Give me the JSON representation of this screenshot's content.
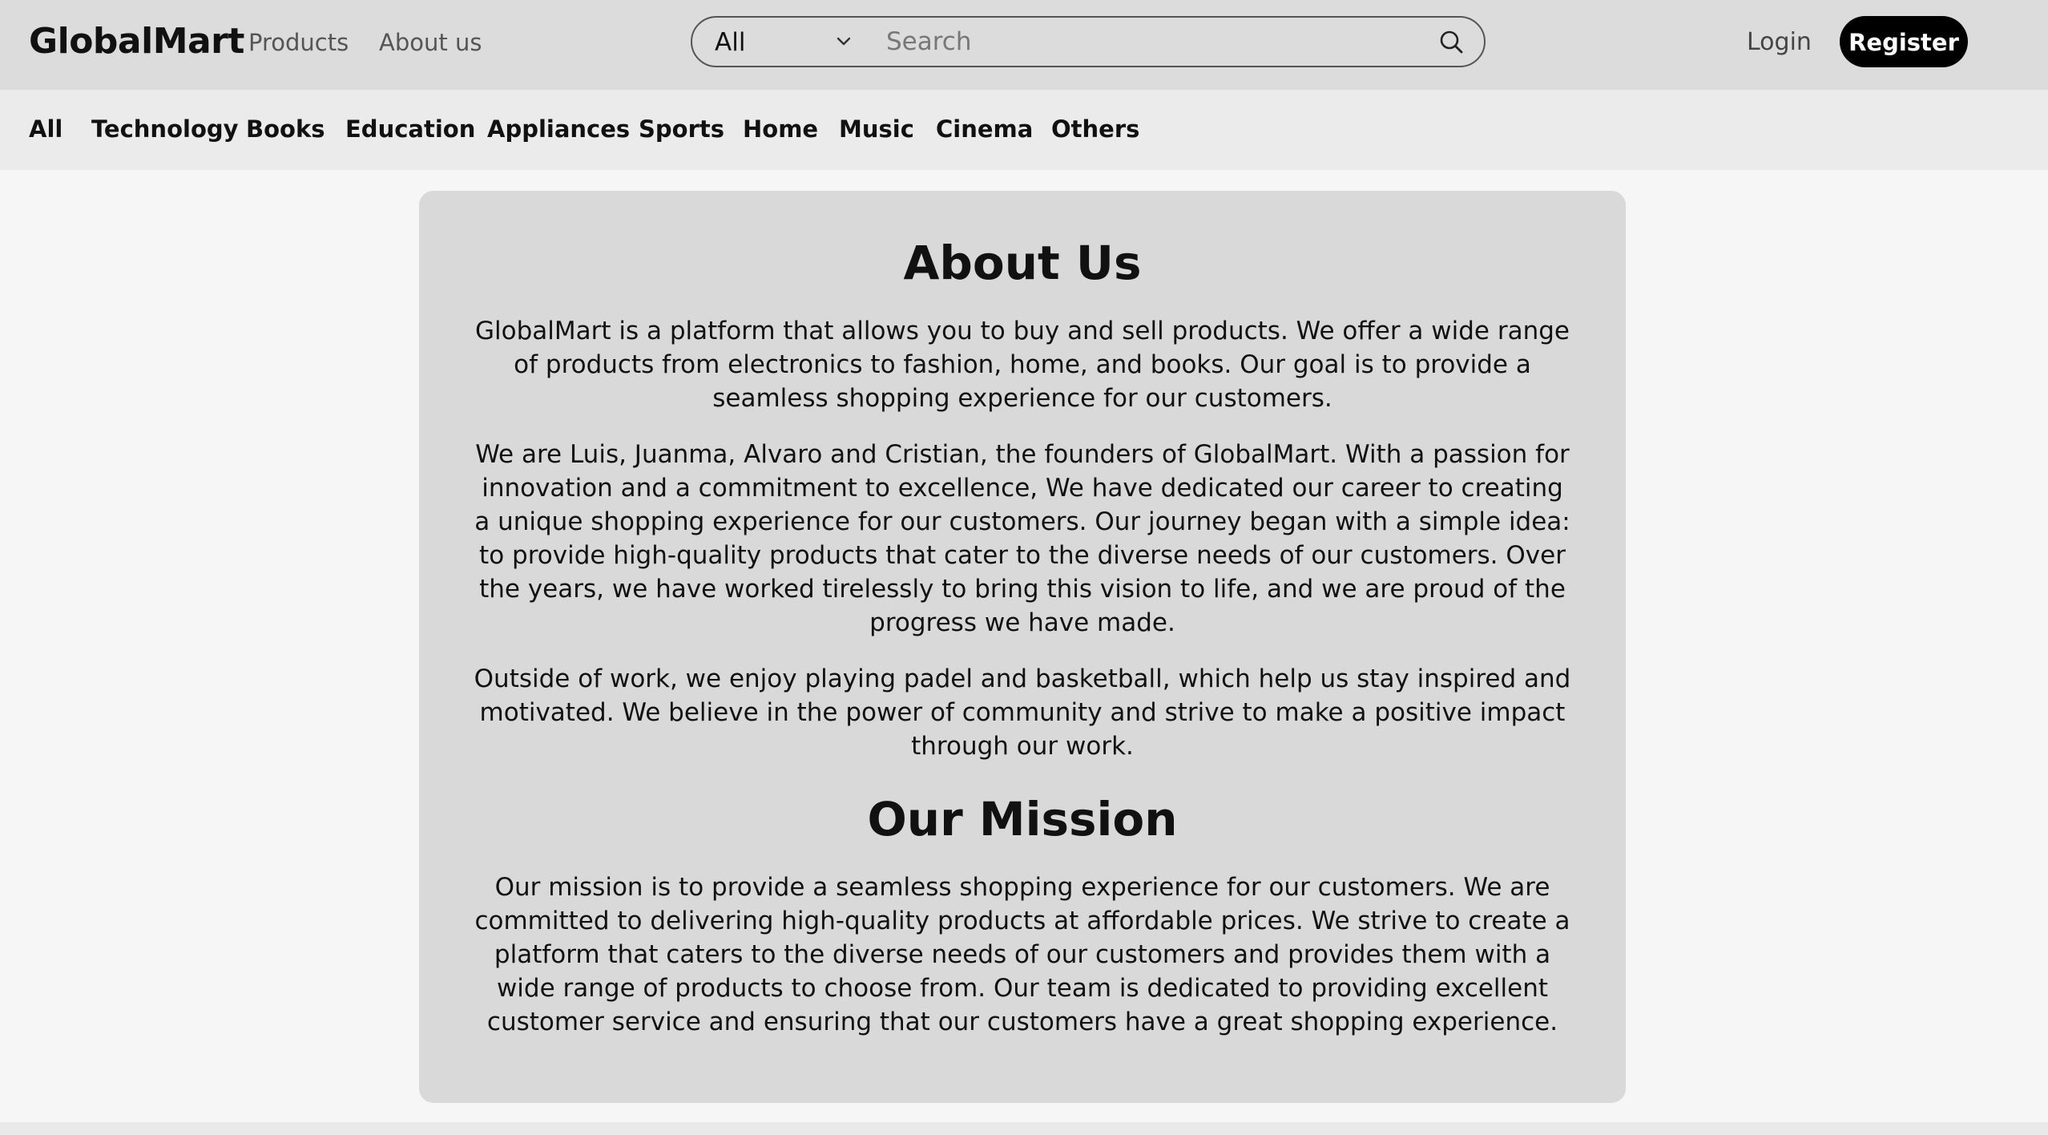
{
  "header": {
    "brand": "GlobalMart",
    "nav": {
      "products": "Products",
      "about": "About us"
    },
    "search": {
      "category_selected": "All",
      "placeholder": "Search",
      "value": ""
    },
    "login_label": "Login",
    "register_label": "Register"
  },
  "categories": [
    "All",
    "Technology",
    "Books",
    "Education",
    "Appliances",
    "Sports",
    "Home",
    "Music",
    "Cinema",
    "Others"
  ],
  "about": {
    "title": "About Us",
    "paragraphs": [
      "GlobalMart is a platform that allows you to buy and sell products. We offer a wide range of products from electronics to fashion, home, and books. Our goal is to provide a seamless shopping experience for our customers.",
      "We are Luis, Juanma, Alvaro and Cristian, the founders of GlobalMart. With a passion for innovation and a commitment to excellence, We have dedicated our career to creating a unique shopping experience for our customers. Our journey began with a simple idea: to provide high-quality products that cater to the diverse needs of our customers. Over the years, we have worked tirelessly to bring this vision to life, and we are proud of the progress we have made.",
      "Outside of work, we enjoy playing padel and basketball, which help us stay inspired and motivated. We believe in the power of community and strive to make a positive impact through our work."
    ]
  },
  "mission": {
    "title": "Our Mission",
    "paragraph": "Our mission is to provide a seamless shopping experience for our customers. We are committed to delivering high-quality products at affordable prices. We strive to create a platform that caters to the diverse needs of our customers and provides them with a wide range of products to choose from. Our team is dedicated to providing excellent customer service and ensuring that our customers have a great shopping experience."
  },
  "icons": {
    "dropdown": "chevron-down-icon",
    "search": "search-icon"
  },
  "colors": {
    "header_bg": "#dcdcdc",
    "category_bg": "#ebebeb",
    "page_bg": "#f6f6f6",
    "card_bg": "#d9d9d9",
    "register_bg": "#000000"
  }
}
